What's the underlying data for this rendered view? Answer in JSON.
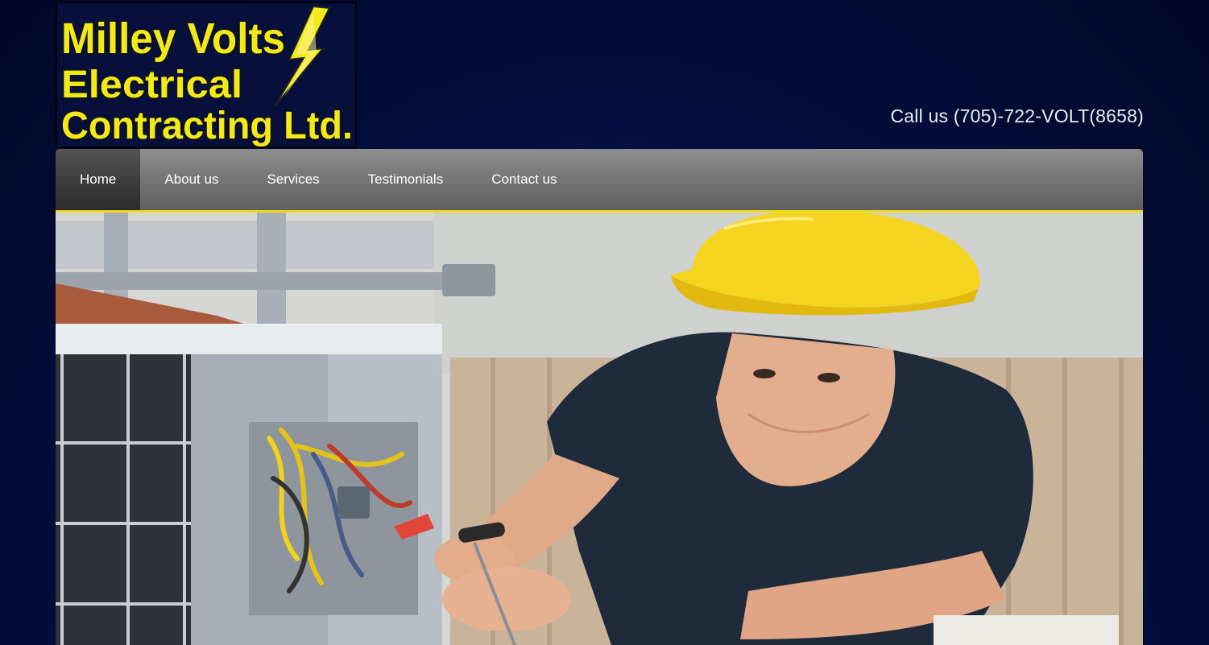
{
  "logo": {
    "line1": "Milley Volts",
    "line2": "Electrical",
    "line3": "Contracting Ltd.",
    "icon": "lightning-bolt-icon"
  },
  "header": {
    "phone_text": "Call us (705)-722-VOLT(8658)"
  },
  "nav": {
    "items": [
      {
        "label": "Home",
        "active": true
      },
      {
        "label": "About us",
        "active": false
      },
      {
        "label": "Services",
        "active": false
      },
      {
        "label": "Testimonials",
        "active": false
      },
      {
        "label": "Contact us",
        "active": false
      }
    ]
  },
  "hero": {
    "image": "electrician-working-on-ac-unit"
  },
  "colors": {
    "background": "#02103f",
    "nav_accent": "#f0dc1a",
    "logo_text": "#f2e91a",
    "nav_text": "#ffffff"
  }
}
